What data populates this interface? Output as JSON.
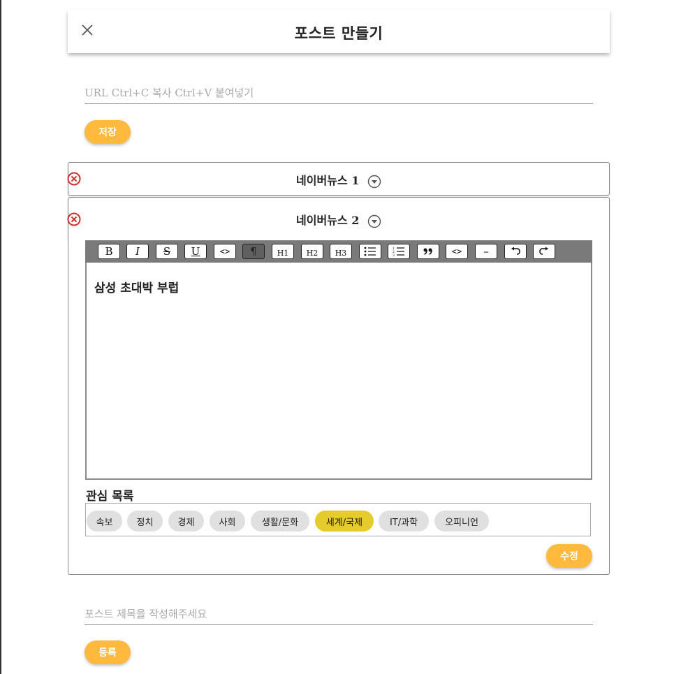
{
  "header": {
    "title": "포스트 만들기"
  },
  "url_input": {
    "placeholder": "URL Ctrl+C 복사 Ctrl+V 붙여넣기",
    "value": ""
  },
  "save_button": "저장",
  "news_items": [
    {
      "title": "네이버뉴스 1"
    },
    {
      "title": "네이버뉴스 2"
    }
  ],
  "toolbar": {
    "buttons": [
      {
        "name": "bold",
        "label": "B"
      },
      {
        "name": "italic",
        "label": "I"
      },
      {
        "name": "strike",
        "label": "S"
      },
      {
        "name": "underline",
        "label": "U"
      },
      {
        "name": "code",
        "label": "<>"
      },
      {
        "name": "paragraph",
        "label": "¶",
        "active": true
      },
      {
        "name": "h1",
        "label": "H1"
      },
      {
        "name": "h2",
        "label": "H2"
      },
      {
        "name": "h3",
        "label": "H3"
      },
      {
        "name": "bullet-list",
        "label": "bullet-list-icon"
      },
      {
        "name": "ordered-list",
        "label": "ordered-list-icon"
      },
      {
        "name": "blockquote",
        "label": "quote-icon"
      },
      {
        "name": "code-block",
        "label": "<>"
      },
      {
        "name": "horizontal-rule",
        "label": "–"
      },
      {
        "name": "undo",
        "label": "undo-icon"
      },
      {
        "name": "redo",
        "label": "redo-icon"
      }
    ]
  },
  "editor": {
    "content": "삼성 초대박 부럽"
  },
  "interests": {
    "label": "관심 목록",
    "chips": [
      {
        "label": "속보",
        "selected": false
      },
      {
        "label": "정치",
        "selected": false
      },
      {
        "label": "경제",
        "selected": false
      },
      {
        "label": "사회",
        "selected": false
      },
      {
        "label": "생활/문화",
        "selected": false
      },
      {
        "label": "세계/국제",
        "selected": true
      },
      {
        "label": "IT/과학",
        "selected": false
      },
      {
        "label": "오피니언",
        "selected": false
      }
    ]
  },
  "edit_button": "수정",
  "post_title_input": {
    "placeholder": "포스트 제목을 작성해주세요",
    "value": ""
  },
  "register_button": "등록",
  "colors": {
    "accent": "#ffb93d",
    "chip_selected": "#e6cb2d",
    "chip": "#e0e0e0",
    "remove": "#d32f2f"
  }
}
